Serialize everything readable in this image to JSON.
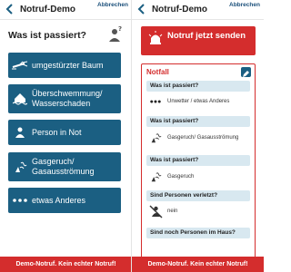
{
  "colors": {
    "accent_blue": "#1b5f82",
    "alert_red": "#d42d2d",
    "question_bg": "#d8e8f0"
  },
  "left": {
    "topbar": {
      "title": "Notruf-Demo",
      "cancel_label": "Abbrechen"
    },
    "question": "Was ist passiert?",
    "options": [
      {
        "icon": "fallen-tree-icon",
        "label": "umgestürzter Baum"
      },
      {
        "icon": "flood-house-icon",
        "label": "Überschwemmung/ Wasserschaden"
      },
      {
        "icon": "person-icon",
        "label": "Person in Not"
      },
      {
        "icon": "gas-leak-icon",
        "label": "Gasgeruch/ Gasausströmung"
      },
      {
        "icon": "dots-icon",
        "label": "etwas Anderes"
      }
    ],
    "footer": "Demo-Notruf. Kein echter Notruf!"
  },
  "right": {
    "topbar": {
      "title": "Notruf-Demo",
      "cancel_label": "Abbrechen"
    },
    "send_label": "Notruf jetzt senden",
    "notfall": {
      "title": "Notfall",
      "entries": [
        {
          "question": "Was ist passiert?",
          "icon": "dots-icon",
          "answer": "Unwetter / etwas Anderes"
        },
        {
          "question": "Was ist passiert?",
          "icon": "gas-leak-icon",
          "answer": "Gasgeruch/ Gasausströmung"
        },
        {
          "question": "Was ist passiert?",
          "icon": "gas-leak-icon",
          "answer": "Gasgeruch"
        },
        {
          "question": "Sind Personen verletzt?",
          "icon": "no-injured-icon",
          "answer": "nein"
        },
        {
          "question": "Sind noch Personen im Haus?",
          "icon": "",
          "answer": ""
        }
      ]
    },
    "footer": "Demo-Notruf. Kein echter Notruf!"
  }
}
